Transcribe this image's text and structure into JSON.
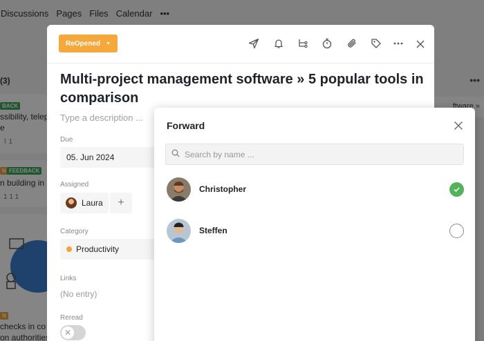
{
  "background": {
    "nav": [
      "Discussions",
      "Pages",
      "Files",
      "Calendar",
      "•••"
    ],
    "column_count": "(3)",
    "card1": {
      "tag": "BACK",
      "lines": [
        "ssibility, telep",
        "e"
      ],
      "meta": "1"
    },
    "card2": {
      "tags": [
        "N",
        "FEEDBACK"
      ],
      "lines": [
        "n building in h"
      ],
      "meta": "1   1   1"
    },
    "card3": {
      "tag": "N",
      "lines": [
        "checks in co",
        "on authorities"
      ]
    },
    "right_header": "•••",
    "right_card": "ftware »"
  },
  "task": {
    "status_label": "ReOpened",
    "title": "Multi-project management software » 5 popular tools in comparison",
    "description_placeholder": "Type a description ...",
    "fields": {
      "due_label": "Due",
      "due_value": "05. Jun 2024",
      "assigned_label": "Assigned",
      "assignee_name": "Laura",
      "add_assignee": "+",
      "category_label": "Category",
      "category_value": "Productivity",
      "links_label": "Links",
      "links_value": "(No entry)",
      "reread_label": "Reread"
    },
    "toolbar_icons": [
      "send-icon",
      "bell-icon",
      "subtask-icon",
      "timer-icon",
      "paperclip-icon",
      "tag-icon",
      "more-icon",
      "close-icon"
    ]
  },
  "forward": {
    "title": "Forward",
    "search_placeholder": "Search by name ...",
    "people": [
      {
        "name": "Christopher",
        "selected": true
      },
      {
        "name": "Steffen",
        "selected": false
      }
    ]
  },
  "colors": {
    "status": "#f6a83c",
    "check": "#52b35a",
    "category_dot": "#f2a33a"
  }
}
